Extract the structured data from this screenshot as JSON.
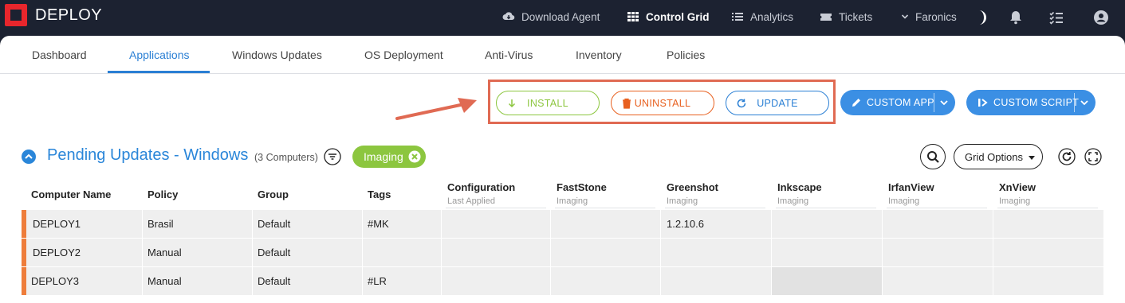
{
  "brand": {
    "logo_text": "DEPLOY"
  },
  "topnav": {
    "download_agent": "Download Agent",
    "control_grid": "Control Grid",
    "analytics": "Analytics",
    "tickets": "Tickets",
    "account": "Faronics"
  },
  "tabs": [
    "Dashboard",
    "Applications",
    "Windows Updates",
    "OS Deployment",
    "Anti-Virus",
    "Inventory",
    "Policies"
  ],
  "actions": {
    "install": "INSTALL",
    "uninstall": "UNINSTALL",
    "update": "UPDATE",
    "custom_app": "CUSTOM APP",
    "custom_script": "CUSTOM SCRIPT"
  },
  "section": {
    "title": "Pending Updates - Windows",
    "count": "(3 Computers)",
    "chip": "Imaging",
    "grid_options": "Grid Options"
  },
  "table": {
    "columns": [
      {
        "label": "Computer Name",
        "sub": ""
      },
      {
        "label": "Policy",
        "sub": ""
      },
      {
        "label": "Group",
        "sub": ""
      },
      {
        "label": "Tags",
        "sub": ""
      },
      {
        "label": "Configuration",
        "sub": "Last Applied"
      },
      {
        "label": "FastStone",
        "sub": "Imaging"
      },
      {
        "label": "Greenshot",
        "sub": "Imaging"
      },
      {
        "label": "Inkscape",
        "sub": "Imaging"
      },
      {
        "label": "IrfanView",
        "sub": "Imaging"
      },
      {
        "label": "XnView",
        "sub": "Imaging"
      }
    ],
    "rows": [
      {
        "cells": [
          "DEPLOY1",
          "Brasil",
          "Default",
          "#MK",
          "",
          "",
          "1.2.10.6",
          "",
          "",
          ""
        ]
      },
      {
        "cells": [
          "DEPLOY2",
          "Manual",
          "Default",
          "",
          "",
          "",
          "",
          "",
          "",
          ""
        ]
      },
      {
        "cells": [
          "DEPLOY3",
          "Manual",
          "Default",
          "#LR",
          "",
          "",
          "",
          "",
          "",
          ""
        ]
      }
    ]
  },
  "colors": {
    "navbar": "#1c2231",
    "brand_red": "#e8262c",
    "accent_blue": "#2a7fd4",
    "install_green": "#8cc63f",
    "uninstall_orange": "#e8601f",
    "highlight_frame": "#e06a53",
    "row_marker": "#ee7d3b"
  },
  "icons": [
    "cloud-download-icon",
    "grid-icon",
    "list-icon",
    "ticket-icon",
    "chevron-down-icon",
    "moon-icon",
    "bell-icon",
    "checklist-icon",
    "user-icon",
    "arrow-down-icon",
    "trash-icon",
    "refresh-icon",
    "pencil-icon",
    "script-icon",
    "collapse-icon",
    "filter-icon",
    "close-circle-icon",
    "search-icon",
    "fullscreen-icon"
  ]
}
